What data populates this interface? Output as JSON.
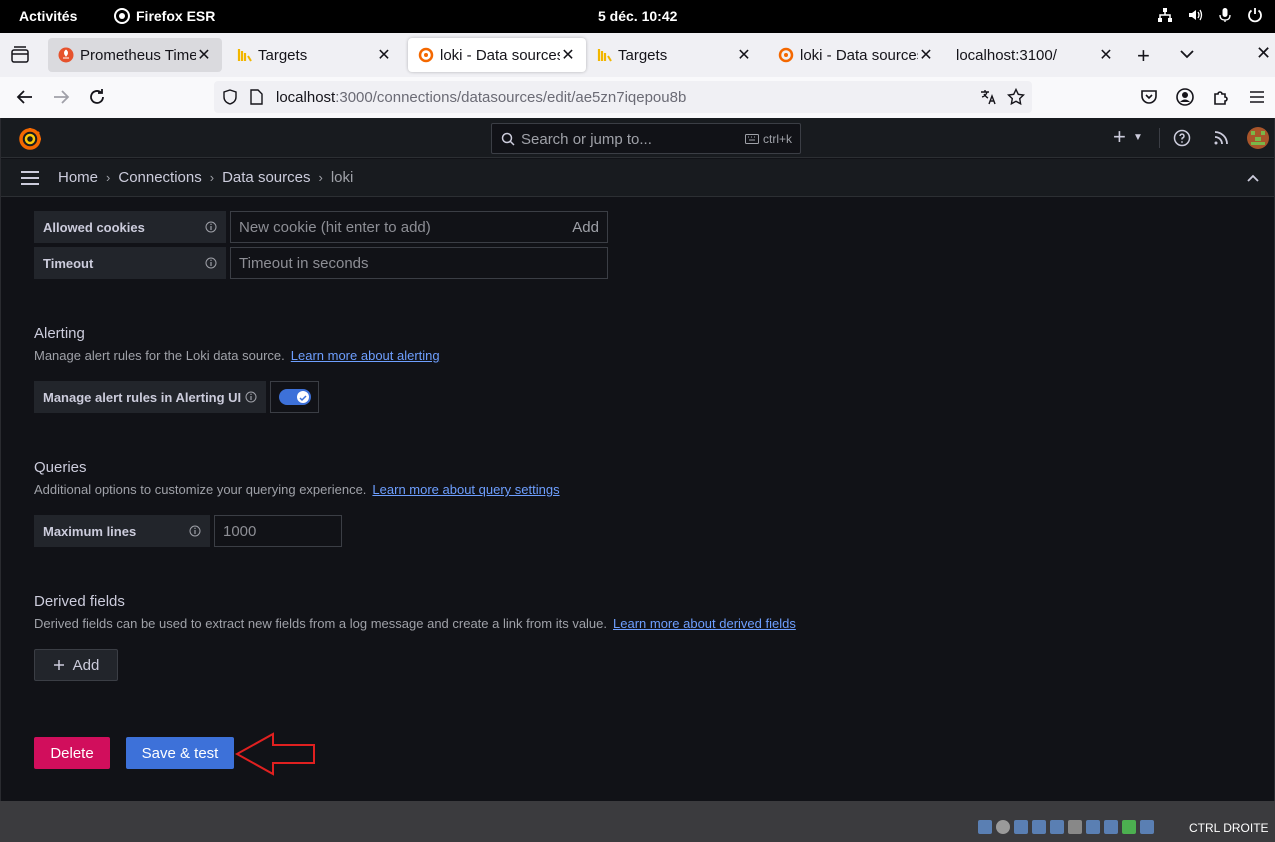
{
  "system_bar": {
    "activities": "Activités",
    "app_name": "Firefox ESR",
    "clock": "5 déc.  10:42"
  },
  "browser": {
    "tabs": [
      {
        "title": "Prometheus Time",
        "favicon": "prometheus-icon",
        "state": "grey"
      },
      {
        "title": "Targets",
        "favicon": "logs-icon",
        "state": "normal"
      },
      {
        "title": "loki - Data sources",
        "favicon": "grafana-icon",
        "state": "active"
      },
      {
        "title": "Targets",
        "favicon": "logs-icon",
        "state": "normal"
      },
      {
        "title": "loki - Data sources",
        "favicon": "grafana-icon",
        "state": "normal"
      },
      {
        "title": "localhost:3100/",
        "favicon": "",
        "state": "normal"
      }
    ],
    "url_host": "localhost",
    "url_rest": ":3000/connections/datasources/edit/ae5zn7iqepou8b"
  },
  "grafana": {
    "search_placeholder": "Search or jump to...",
    "search_shortcut": "ctrl+k",
    "breadcrumb": [
      "Home",
      "Connections",
      "Data sources",
      "loki"
    ],
    "http": {
      "allowed_cookies_label": "Allowed cookies",
      "allowed_cookies_placeholder": "New cookie (hit enter to add)",
      "allowed_cookies_add": "Add",
      "timeout_label": "Timeout",
      "timeout_placeholder": "Timeout in seconds"
    },
    "alerting": {
      "title": "Alerting",
      "description": "Manage alert rules for the Loki data source.",
      "link": "Learn more about alerting",
      "toggle_label": "Manage alert rules in Alerting UI",
      "toggle_on": true
    },
    "queries": {
      "title": "Queries",
      "description": "Additional options to customize your querying experience.",
      "link": "Learn more about query settings",
      "max_lines_label": "Maximum lines",
      "max_lines_placeholder": "1000"
    },
    "derived_fields": {
      "title": "Derived fields",
      "description": "Derived fields can be used to extract new fields from a log message and create a link from its value.",
      "link": "Learn more about derived fields",
      "add_label": "Add"
    },
    "actions": {
      "delete_label": "Delete",
      "save_label": "Save & test"
    }
  },
  "vm_status": {
    "host_key": "CTRL DROITE"
  },
  "colors": {
    "accent_blue": "#3d71d9",
    "danger": "#d10e5c",
    "annotation_arrow": "#e02020",
    "link": "#6e9fff"
  }
}
